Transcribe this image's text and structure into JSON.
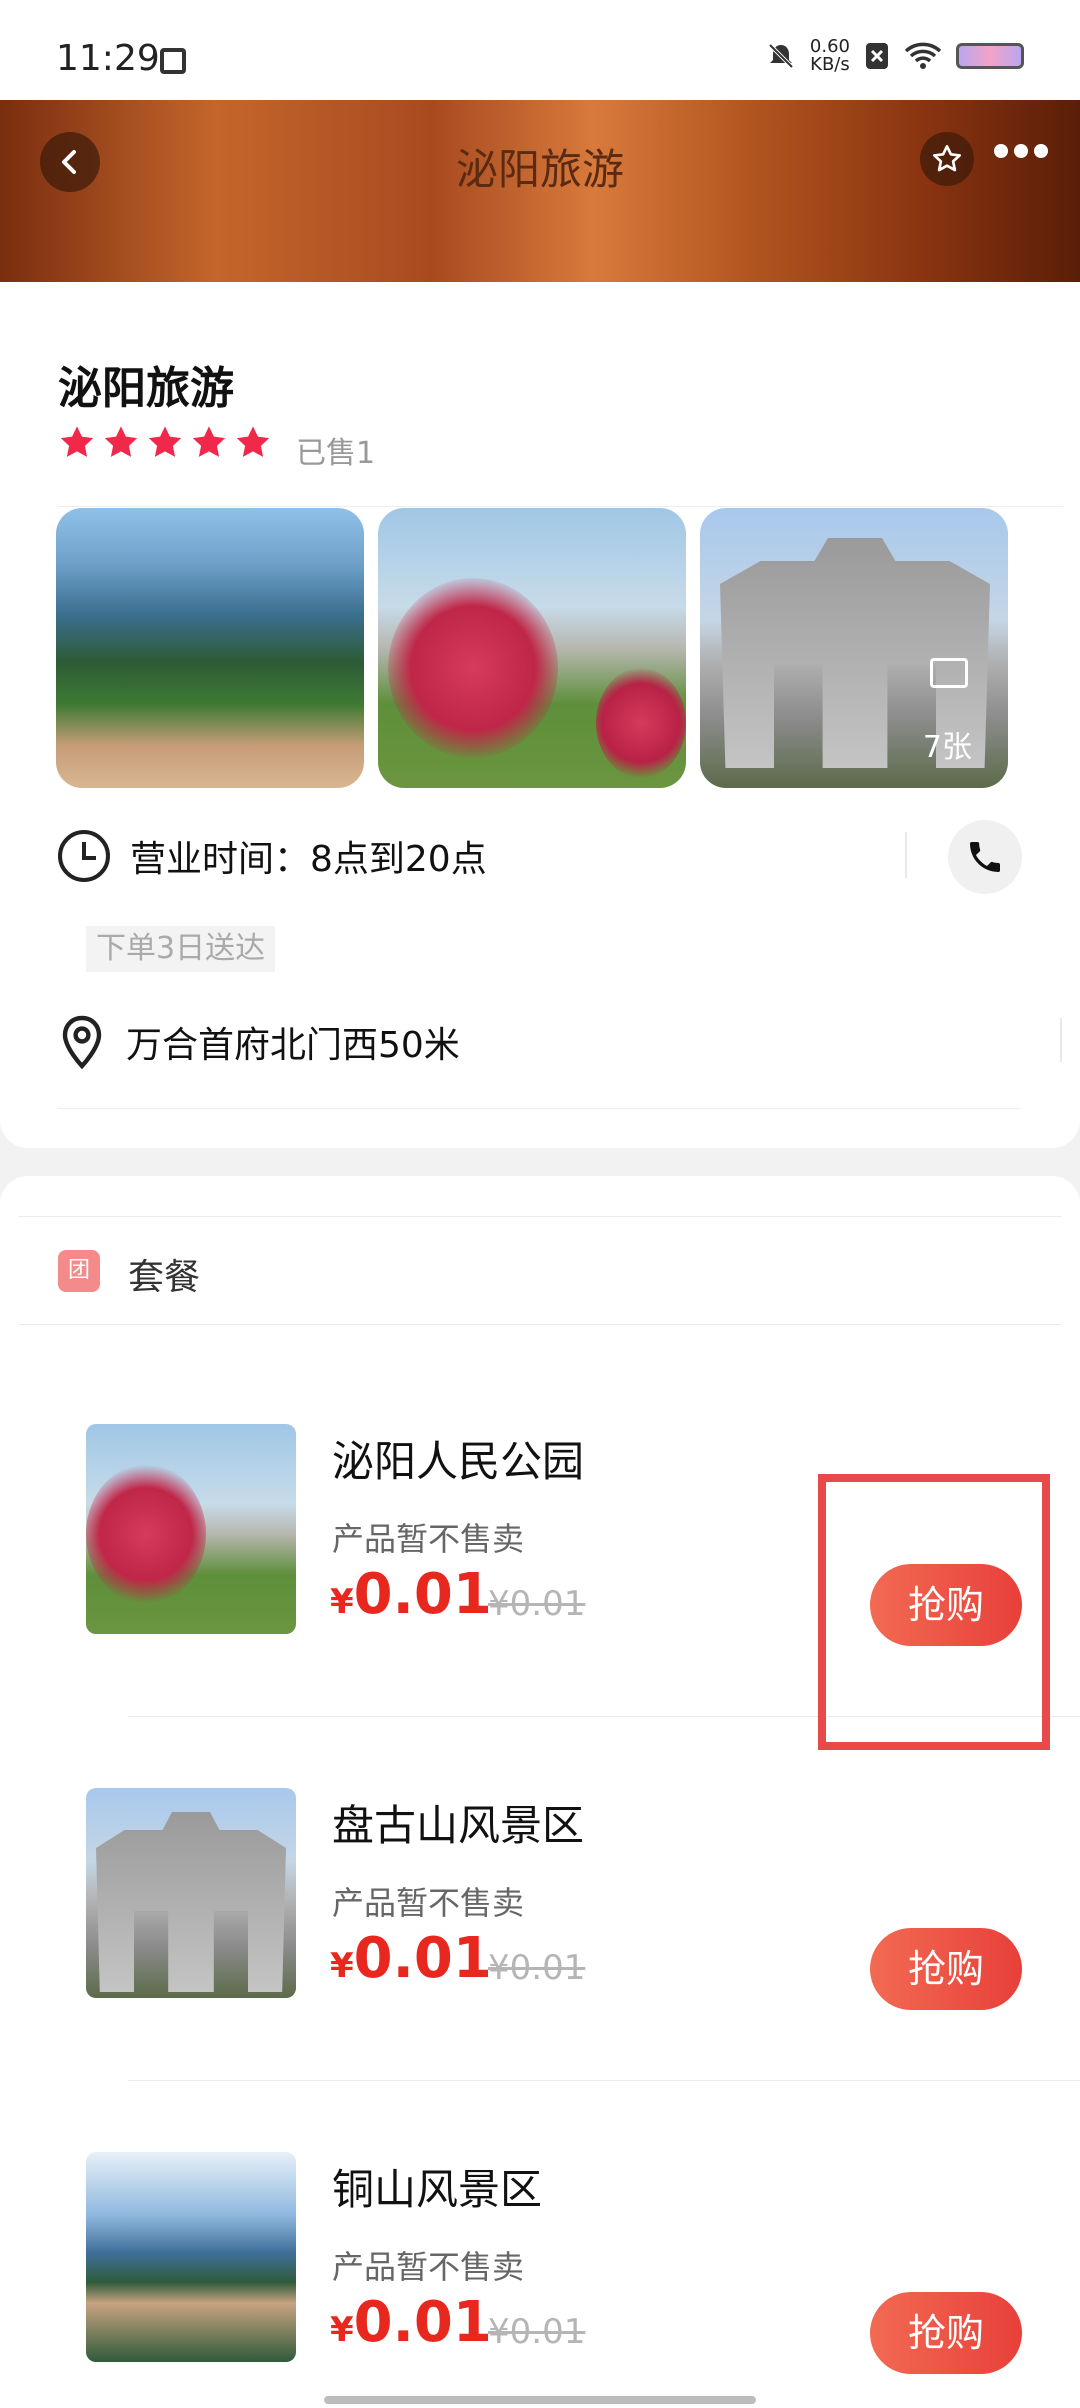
{
  "status_bar": {
    "time": "11:29",
    "speed_value": "0.60",
    "speed_unit": "KB/s"
  },
  "header": {
    "title": "泌阳旅游"
  },
  "shop": {
    "name": "泌阳旅游",
    "rating_stars": 5,
    "sold": "已售1",
    "photo_count": "7张",
    "hours": "营业时间：8点到20点",
    "delivery_tag": "下单3日送达",
    "address": "万合首府北门西50米"
  },
  "packages": {
    "badge": "团",
    "title": "套餐",
    "items": [
      {
        "name": "泌阳人民公园",
        "status": "产品暂不售卖",
        "currency": "¥",
        "price": "0.01",
        "original_price": "¥0.01",
        "buy_label": "抢购"
      },
      {
        "name": "盘古山风景区",
        "status": "产品暂不售卖",
        "currency": "¥",
        "price": "0.01",
        "original_price": "¥0.01",
        "buy_label": "抢购"
      },
      {
        "name": "铜山风景区",
        "status": "产品暂不售卖",
        "currency": "¥",
        "price": "0.01",
        "original_price": "¥0.01",
        "buy_label": "抢购"
      }
    ]
  },
  "colors": {
    "accent_red": "#e8271e",
    "buy_button": "#e8403a",
    "star": "#f0284a",
    "highlight_box": "#e84a4a"
  }
}
